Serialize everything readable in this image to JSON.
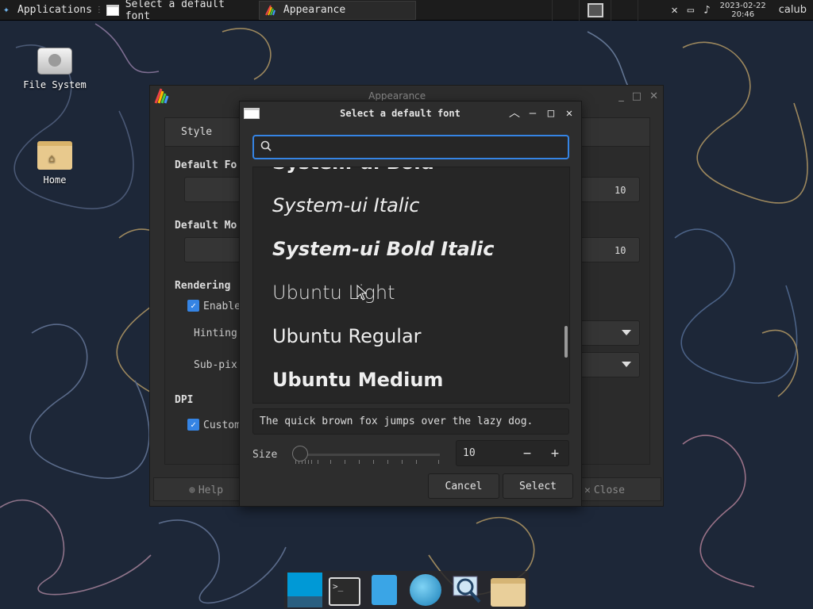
{
  "top_panel": {
    "applications_label": "Applications",
    "tasks": [
      {
        "label": "Select a default font",
        "icon": "window-icon",
        "active": false
      },
      {
        "label": "Appearance",
        "icon": "appearance-icon",
        "active": true
      }
    ],
    "clock": {
      "date": "2023-02-22",
      "time": "20:46"
    },
    "user": "calub",
    "tray_icons": [
      "mic-muted-icon",
      "battery-icon",
      "notification-bell-icon"
    ]
  },
  "desktop": {
    "icons": [
      {
        "label": "File System",
        "icon": "drive-icon"
      },
      {
        "label": "Home",
        "icon": "home-folder-icon"
      }
    ]
  },
  "appearance_window": {
    "title": "Appearance",
    "tab_style": "Style",
    "default_font_label": "Default Fo",
    "default_font_size": "10",
    "default_mono_label": "Default Mo",
    "default_mono_size": "10",
    "rendering_label": "Rendering",
    "enable_label": "Enable",
    "hinting_label": "Hinting",
    "subpixel_label": "Sub-pix",
    "dpi_label": "DPI",
    "custom_label": "Custom",
    "help_label": "Help",
    "close_label": "Close"
  },
  "font_dialog": {
    "title": "Select a default font",
    "search": {
      "value": "",
      "placeholder": ""
    },
    "fonts": [
      {
        "name": "System-ui Bold"
      },
      {
        "name": "System-ui Italic"
      },
      {
        "name": "System-ui Bold Italic"
      },
      {
        "name": "Ubuntu Light"
      },
      {
        "name": "Ubuntu Regular"
      },
      {
        "name": "Ubuntu Medium"
      }
    ],
    "preview_text": "The quick brown fox jumps over the lazy dog.",
    "size_label": "Size",
    "size_value": "10",
    "minus_label": "−",
    "plus_label": "+",
    "cancel_label": "Cancel",
    "select_label": "Select"
  },
  "dock": {
    "items": [
      "show-desktop-icon",
      "terminal-icon",
      "file-manager-icon",
      "web-browser-icon",
      "app-finder-icon",
      "home-folder-icon"
    ]
  },
  "colors": {
    "accent": "#3584e4",
    "panel": "#1c1c1c",
    "window_bg": "#2d2d2d",
    "wallpaper": "#1e2a3e"
  }
}
